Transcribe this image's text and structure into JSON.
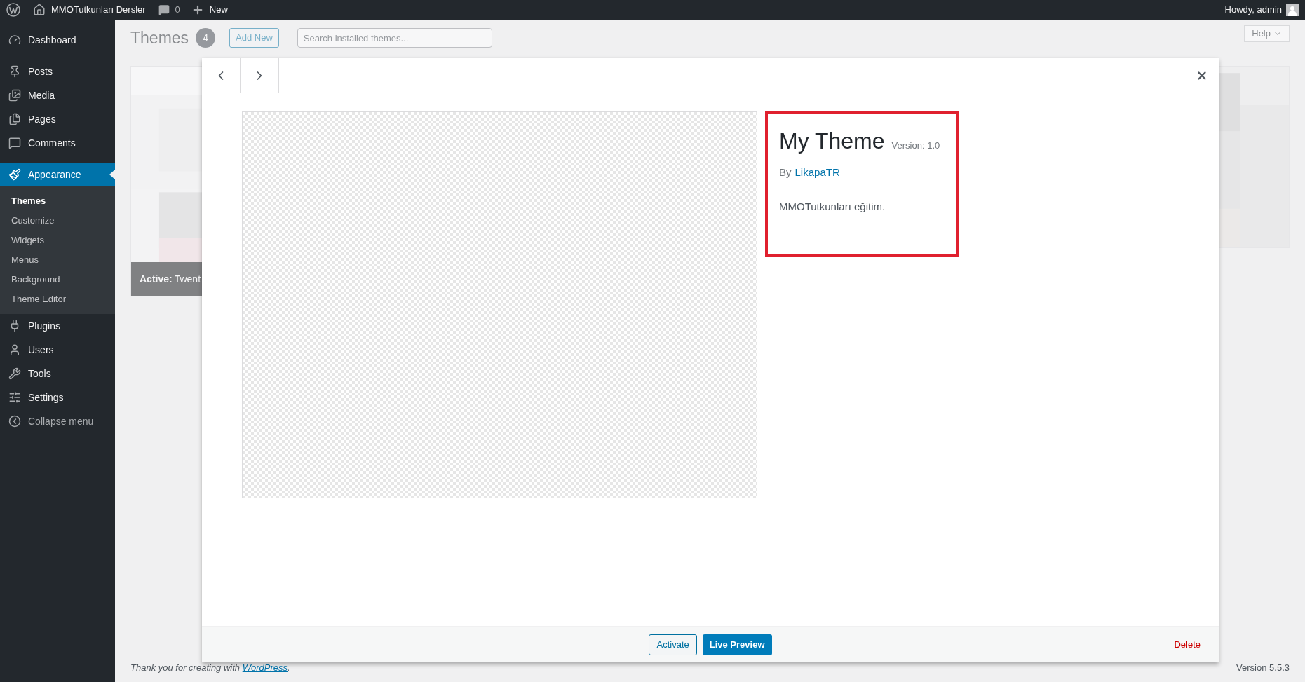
{
  "admin_bar": {
    "site_name": "MMOTutkunları Dersler",
    "comments_count": "0",
    "new_label": "New",
    "greeting": "Howdy, admin"
  },
  "sidebar": {
    "items": [
      {
        "label": "Dashboard",
        "selected": false
      },
      {
        "label": "Posts",
        "selected": false
      },
      {
        "label": "Media",
        "selected": false
      },
      {
        "label": "Pages",
        "selected": false
      },
      {
        "label": "Comments",
        "selected": false
      },
      {
        "label": "Appearance",
        "selected": true,
        "children": [
          {
            "label": "Themes",
            "selected": true
          },
          {
            "label": "Customize",
            "selected": false
          },
          {
            "label": "Widgets",
            "selected": false
          },
          {
            "label": "Menus",
            "selected": false
          },
          {
            "label": "Background",
            "selected": false
          },
          {
            "label": "Theme Editor",
            "selected": false
          }
        ]
      },
      {
        "label": "Plugins",
        "selected": false
      },
      {
        "label": "Users",
        "selected": false
      },
      {
        "label": "Tools",
        "selected": false
      },
      {
        "label": "Settings",
        "selected": false
      }
    ],
    "collapse_label": "Collapse menu"
  },
  "background_page": {
    "title": "Themes",
    "count": "4",
    "add_new": "Add New",
    "search_placeholder": "Search installed themes...",
    "help": "Help",
    "active_label": "Active:",
    "active_name": "Twent"
  },
  "theme_details": {
    "name": "My Theme",
    "version": "Version: 1.0",
    "author_prefix": "By",
    "author": "LikapaTR",
    "description": "MMOTutkunları eğitim.",
    "highlighted": true
  },
  "modal_actions": [
    {
      "label": "Activate",
      "kind": "secondary"
    },
    {
      "label": "Live Preview",
      "kind": "primary"
    },
    {
      "label": "Delete",
      "kind": "danger"
    }
  ],
  "page_footer": {
    "thanks": "Thank you for creating with",
    "link": "WordPress",
    "suffix": ".",
    "version": "Version 5.5.3"
  }
}
